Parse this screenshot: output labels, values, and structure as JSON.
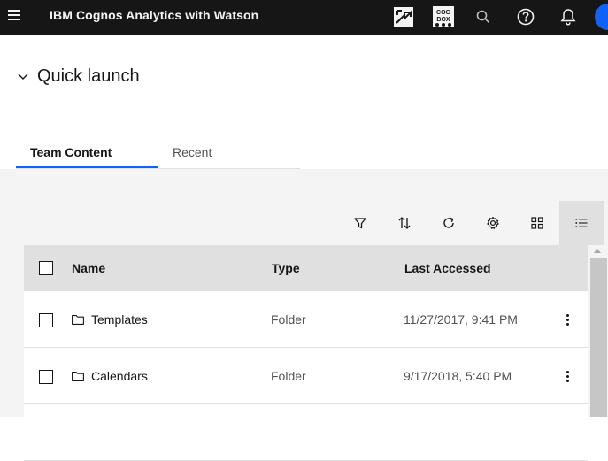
{
  "header": {
    "app_title_prefix": "IBM",
    "app_title_name": "Cognos Analytics with Watson",
    "icons": [
      "menu-icon",
      "launch-icon",
      "cogbox-icon",
      "search-icon",
      "help-icon",
      "notification-icon",
      "user-avatar"
    ],
    "cogbox_label_top": "COG",
    "cogbox_label_bottom": "BOX"
  },
  "quick_launch": {
    "label": "Quick launch",
    "expanded": false
  },
  "tabs": [
    {
      "label": "Team Content",
      "selected": true
    },
    {
      "label": "Recent",
      "selected": false
    }
  ],
  "toolbar": {
    "buttons": [
      "filter-icon",
      "sort-icon",
      "refresh-icon",
      "settings-icon",
      "grid-view-icon",
      "list-view-icon"
    ],
    "active_view": "list"
  },
  "table": {
    "columns": [
      "Name",
      "Type",
      "Last Accessed"
    ],
    "rows": [
      {
        "name": "Templates",
        "type": "Folder",
        "last_accessed": "11/27/2017, 9:41 PM"
      },
      {
        "name": "Calendars",
        "type": "Folder",
        "last_accessed": "9/17/2018, 5:40 PM"
      }
    ]
  },
  "colors": {
    "header_bg": "#161616",
    "accent": "#0f62fe",
    "content_bg": "#f4f4f4",
    "table_header_bg": "#e0e0e0"
  }
}
